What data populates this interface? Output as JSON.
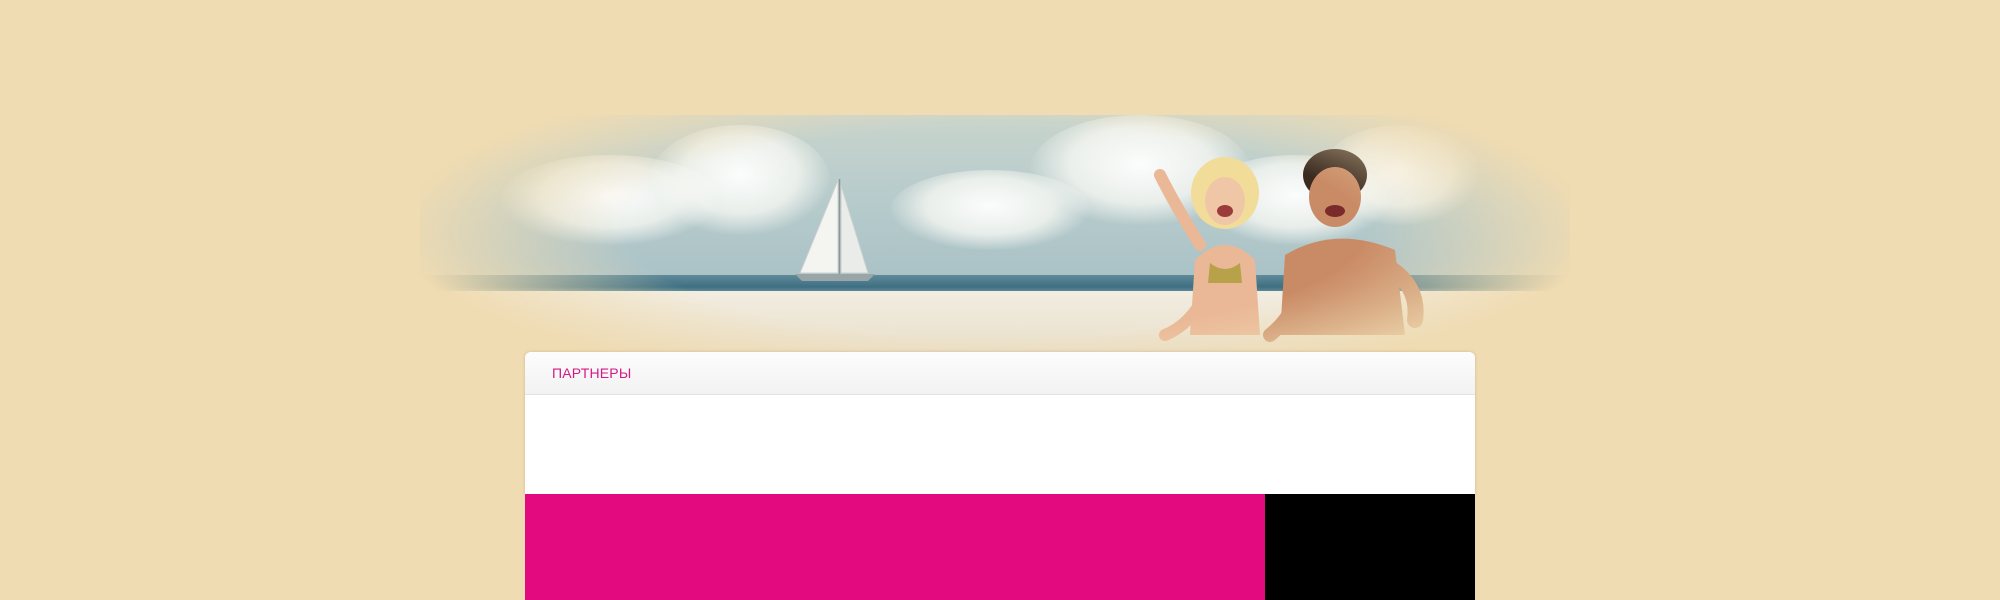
{
  "header": {
    "banner_alt": "beach-banner"
  },
  "partners": {
    "title": "ПАРТНЕРЫ"
  },
  "colors": {
    "page_background": "#f0dcb2",
    "accent_pink": "#e3097f",
    "title_pink": "#d41a86",
    "footer_black": "#000000"
  },
  "icons": {
    "sailboat": "sailboat-icon",
    "people": "couple-illustration"
  }
}
